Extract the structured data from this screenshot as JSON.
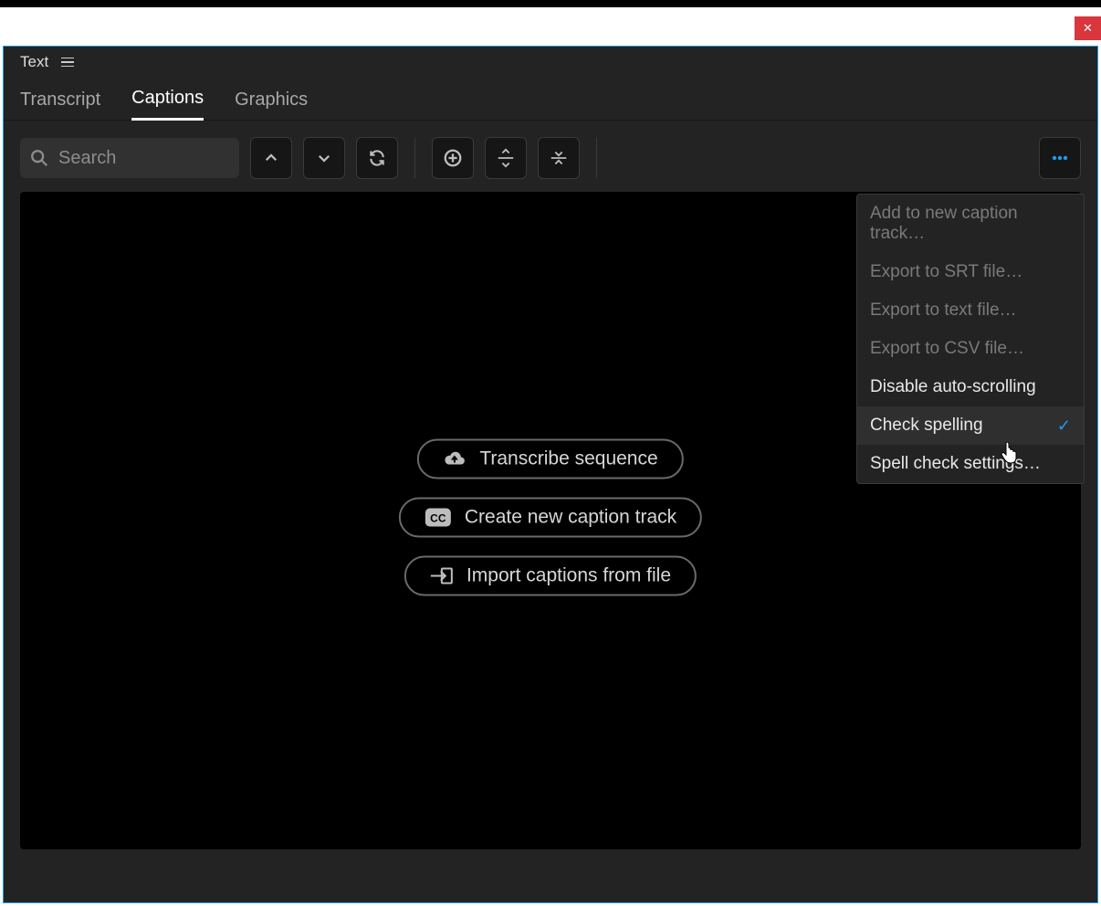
{
  "window": {
    "close_icon": "✕"
  },
  "panel": {
    "title": "Text"
  },
  "tabs": {
    "transcript": "Transcript",
    "captions": "Captions",
    "graphics": "Graphics"
  },
  "search": {
    "placeholder": "Search"
  },
  "empty_actions": {
    "transcribe": "Transcribe sequence",
    "create_track": "Create new caption track",
    "import": "Import captions from file"
  },
  "menu": {
    "add_track": "Add to new caption track…",
    "export_srt": "Export to SRT file…",
    "export_txt": "Export to text file…",
    "export_csv": "Export to CSV file…",
    "disable_autoscroll": "Disable auto-scrolling",
    "check_spelling": "Check spelling",
    "spellcheck_settings": "Spell check settings…"
  }
}
